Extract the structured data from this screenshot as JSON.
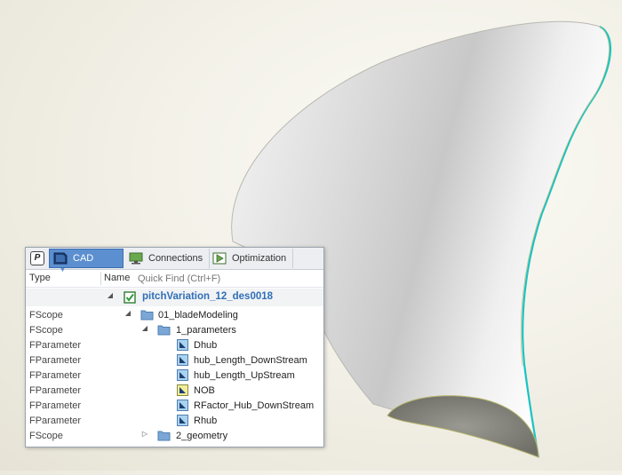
{
  "tabs": [
    {
      "label": "",
      "icon": "p-logo-icon"
    },
    {
      "label": "CAD",
      "icon": "cad-icon",
      "active": true
    },
    {
      "label": "Connections",
      "icon": "monitor-icon"
    },
    {
      "label": "Optimization",
      "icon": "play-icon"
    }
  ],
  "header": {
    "type_label": "Type",
    "name_label": "Name",
    "search_placeholder": "Quick Find (Ctrl+F)"
  },
  "tree": {
    "root": {
      "name": "pitchVariation_12_des0018",
      "checked": true
    },
    "rows": [
      {
        "type": "FScope",
        "name": "01_bladeModeling",
        "expanded": true
      },
      {
        "type": "FScope",
        "name": "1_parameters",
        "expanded": true
      },
      {
        "type": "FParameter",
        "name": "Dhub"
      },
      {
        "type": "FParameter",
        "name": "hub_Length_DownStream"
      },
      {
        "type": "FParameter",
        "name": "hub_Length_UpStream"
      },
      {
        "type": "FParameter",
        "name": "NOB"
      },
      {
        "type": "FParameter",
        "name": "RFactor_Hub_DownStream"
      },
      {
        "type": "FParameter",
        "name": "Rhub"
      },
      {
        "type": "FScope",
        "name": "2_geometry",
        "expanded": false
      }
    ]
  },
  "colors": {
    "active_tab": "#5b8fd0",
    "root_text": "#2e6fb7",
    "blade_edge": "#19c3c3",
    "folder": "#7ba7d6",
    "param_icon": "#a9d3ef",
    "param_icon_highlight": "#f2ee9a"
  }
}
